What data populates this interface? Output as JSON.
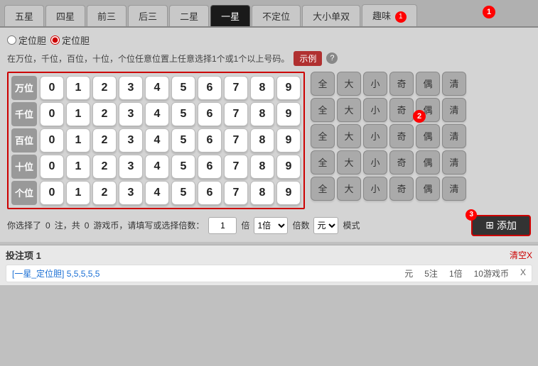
{
  "tabs": [
    {
      "id": "tab-5star",
      "label": "五星",
      "active": false
    },
    {
      "id": "tab-4star",
      "label": "四星",
      "active": false
    },
    {
      "id": "tab-front3",
      "label": "前三",
      "active": false
    },
    {
      "id": "tab-back3",
      "label": "后三",
      "active": false
    },
    {
      "id": "tab-2star",
      "label": "二星",
      "active": false
    },
    {
      "id": "tab-1star",
      "label": "一星",
      "active": true
    },
    {
      "id": "tab-notfixed",
      "label": "不定位",
      "active": false
    },
    {
      "id": "tab-bigsmall",
      "label": "大小单双",
      "active": false
    },
    {
      "id": "tab-fun",
      "label": "趣味",
      "active": false,
      "badge": "1"
    }
  ],
  "radio_options": [
    {
      "label": "定位胆",
      "selected": false
    },
    {
      "label": "定位胆",
      "selected": true
    }
  ],
  "description": "在万位，千位，百位，十位，个位任意位置上任意选择1个或1个以上号码。",
  "example_btn": "示例",
  "help_icon": "?",
  "digit_rows": [
    {
      "label": "万位",
      "numbers": [
        "0",
        "1",
        "2",
        "3",
        "4",
        "5",
        "6",
        "7",
        "8",
        "9"
      ]
    },
    {
      "label": "千位",
      "numbers": [
        "0",
        "1",
        "2",
        "3",
        "4",
        "5",
        "6",
        "7",
        "8",
        "9"
      ]
    },
    {
      "label": "百位",
      "numbers": [
        "0",
        "1",
        "2",
        "3",
        "4",
        "5",
        "6",
        "7",
        "8",
        "9"
      ]
    },
    {
      "label": "十位",
      "numbers": [
        "0",
        "1",
        "2",
        "3",
        "4",
        "5",
        "6",
        "7",
        "8",
        "9"
      ]
    },
    {
      "label": "个位",
      "numbers": [
        "0",
        "1",
        "2",
        "3",
        "4",
        "5",
        "6",
        "7",
        "8",
        "9"
      ]
    }
  ],
  "quick_btns": [
    "全",
    "大",
    "小",
    "奇",
    "偶",
    "清"
  ],
  "bottom": {
    "text1": "你选择了",
    "count_num": "0",
    "text2": "注，共",
    "coin_num": "0",
    "text3": "游戏币，请填写或选择倍数：",
    "input_val": "1",
    "multiplier1_label": "1倍",
    "multiplier2_label": "倍数",
    "unit_label": "元",
    "mode_label": "模式",
    "add_icon": "⊞",
    "add_label": "添加"
  },
  "bet_list": {
    "title": "投注项",
    "count": "1",
    "clear_label": "清空X",
    "items": [
      {
        "label": "[一星_定位胆]",
        "value": "5,5,5,5,5",
        "currency": "元",
        "notes": "5注",
        "multiplier": "1倍",
        "coins": "10游戏币",
        "remove": "X"
      }
    ]
  },
  "badge_number": "1",
  "circle_numbers": {
    "num1": "1",
    "num2": "2",
    "num3": "3"
  }
}
